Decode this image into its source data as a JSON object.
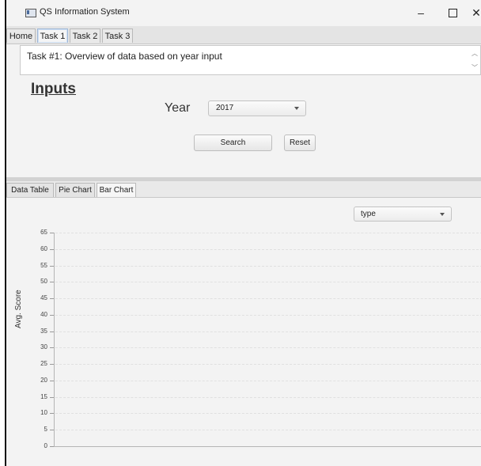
{
  "window": {
    "title": "QS Information System",
    "minimize": "–",
    "close": "✕"
  },
  "tabs": [
    "Home",
    "Task 1",
    "Task 2",
    "Task 3"
  ],
  "active_tab": "Task 1",
  "description": "Task #1: Overview of data based on year input",
  "inputs": {
    "heading": "Inputs",
    "year_label": "Year",
    "year_value": "2017",
    "search_label": "Search",
    "reset_label": "Reset"
  },
  "result_tabs": [
    "Data Table",
    "Pie Chart",
    "Bar Chart"
  ],
  "active_result_tab": "Bar Chart",
  "chart_controls": {
    "type_value": "type"
  },
  "chart_data": {
    "type": "bar",
    "categories": [],
    "series": [],
    "xlabel": "",
    "ylabel": "Avg. Score",
    "ylim": [
      0,
      65
    ],
    "yticks": [
      "0",
      "5",
      "10",
      "15",
      "20",
      "25",
      "30",
      "35",
      "40",
      "45",
      "50",
      "55",
      "60",
      "65"
    ],
    "grid": true
  },
  "icons": [
    "app-icon",
    "minimize-icon",
    "maximize-icon",
    "close-icon",
    "chevron-down-icon",
    "scroll-up-icon",
    "scroll-down-icon"
  ]
}
